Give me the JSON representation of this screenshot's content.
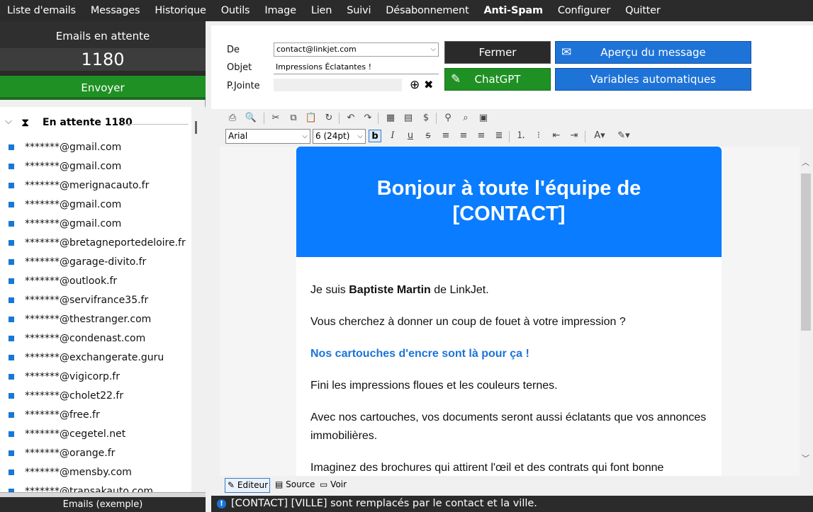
{
  "menu": [
    "Liste d'emails",
    "Messages",
    "Historique",
    "Outils",
    "Image",
    "Lien",
    "Suivi",
    "Désabonnement",
    "Anti-Spam",
    "Configurer",
    "Quitter"
  ],
  "left": {
    "pending_title": "Emails en attente",
    "pending_count": "1180",
    "send_label": "Envoyer",
    "group_label": "En attente 1180",
    "emails": [
      "*******@gmail.com",
      "*******@gmail.com",
      "*******@merignacauto.fr",
      "*******@gmail.com",
      "*******@gmail.com",
      "*******@bretagneportedeloire.fr",
      "*******@garage-divito.fr",
      "*******@outlook.fr",
      "*******@servifrance35.fr",
      "*******@thestranger.com",
      "*******@condenast.com",
      "*******@exchangerate.guru",
      "*******@vigicorp.fr",
      "*******@cholet22.fr",
      "*******@free.fr",
      "*******@cegetel.net",
      "*******@orange.fr",
      "*******@mensby.com",
      "*******@transakauto.com"
    ],
    "footer": "Emails (exemple)"
  },
  "form": {
    "from_label": "De",
    "from_value": "contact@linkjet.com",
    "subject_label": "Objet",
    "subject_value": "Impressions Éclatantes !",
    "attach_label": "P.Jointe",
    "attach_value": ""
  },
  "buttons": {
    "close": "Fermer",
    "preview": "Aperçu du message",
    "chatgpt": "ChatGPT",
    "variables": "Variables automatiques"
  },
  "format": {
    "font": "Arial",
    "size": "6 (24pt)"
  },
  "email": {
    "headline_line1": "Bonjour à toute l'équipe de",
    "headline_line2": "[CONTACT]",
    "intro_prefix": "Je suis ",
    "intro_name": "Baptiste Martin",
    "intro_suffix": " de LinkJet.",
    "p1": "Vous cherchez à donner un coup de fouet à votre impression ?",
    "p2": "Nos cartouches d'encre sont là pour ça !",
    "p3": "Fini les impressions floues et les couleurs ternes.",
    "p4": "Avec nos cartouches, vos documents seront aussi éclatants que vos annonces immobilières.",
    "p5": "Imaginez des brochures qui attirent l'œil et des contrats qui font bonne impression."
  },
  "tabs": {
    "editor": "Editeur",
    "source": "Source",
    "view": "Voir"
  },
  "status": "[CONTACT] [VILLE] sont remplacés par le contact et la ville.",
  "colors": {
    "accent_blue": "#0a7cff",
    "send_green": "#1f9124",
    "dark": "#2b2b2b"
  }
}
